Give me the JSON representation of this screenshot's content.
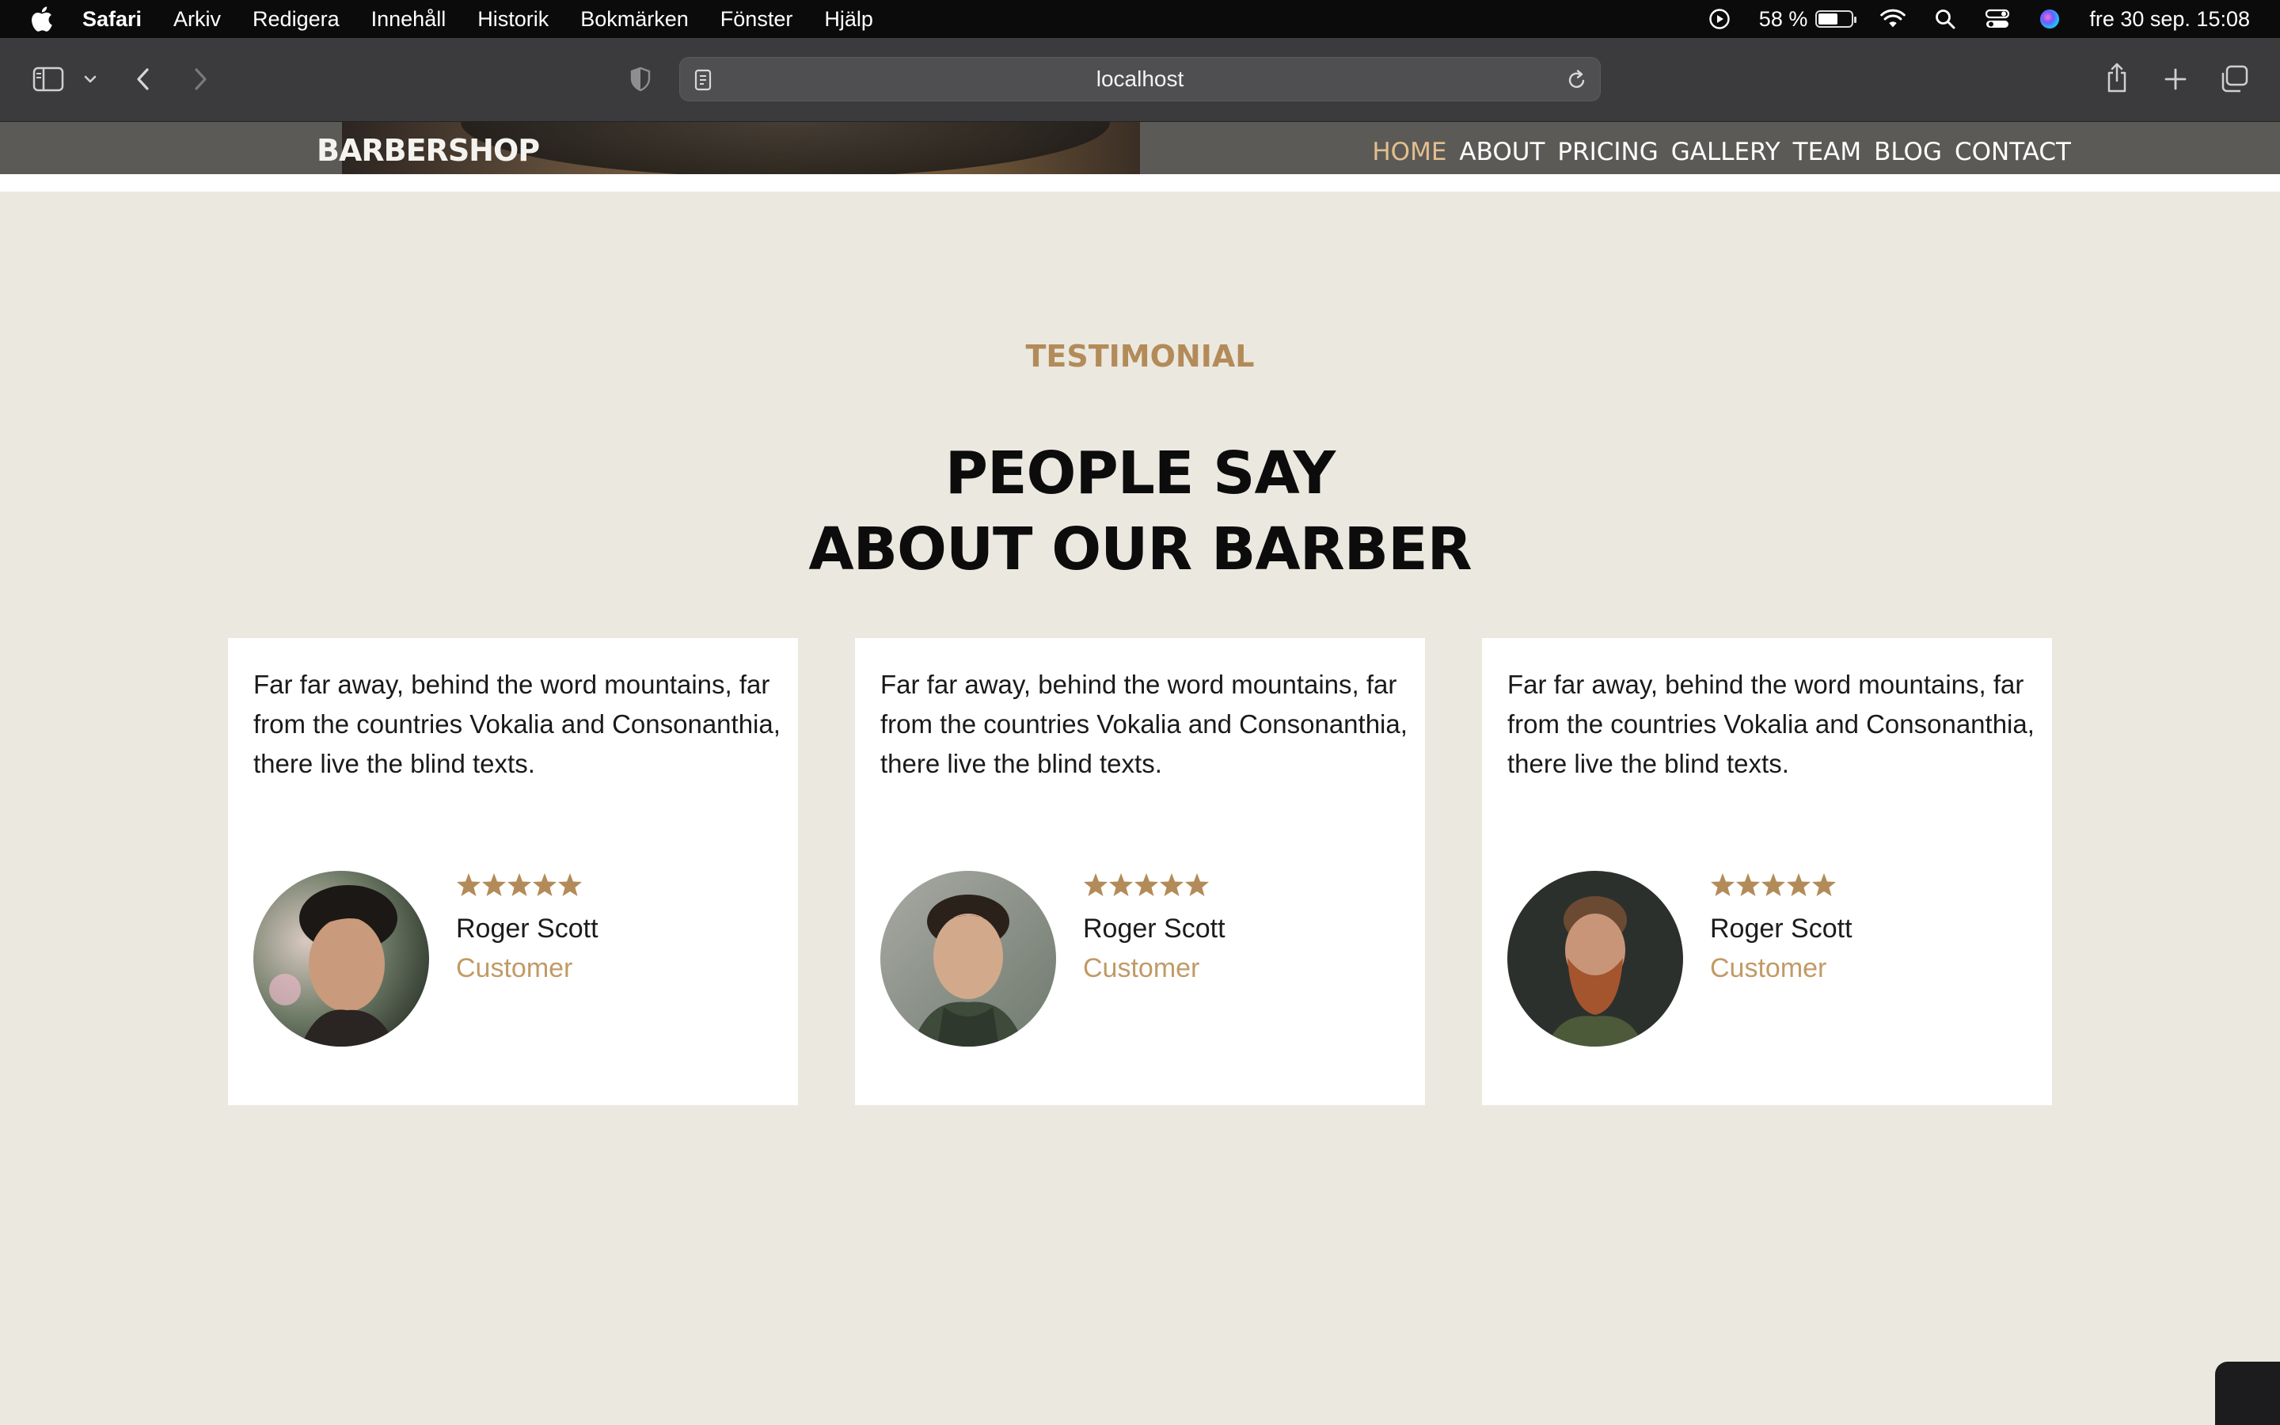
{
  "menubar": {
    "app_name": "Safari",
    "menus": [
      "Arkiv",
      "Redigera",
      "Innehåll",
      "Historik",
      "Bokmärken",
      "Fönster",
      "Hjälp"
    ],
    "battery_text": "58 %",
    "battery_level": 0.58,
    "datetime": "fre 30 sep.  15:08"
  },
  "browser": {
    "url": "localhost"
  },
  "site": {
    "logo": "BARBERSHOP",
    "nav": [
      "HOME",
      "ABOUT",
      "PRICING",
      "GALLERY",
      "TEAM",
      "BLOG",
      "CONTACT"
    ],
    "nav_active": "HOME"
  },
  "testimonial": {
    "eyebrow": "TESTIMONIAL",
    "heading_line1": "PEOPLE SAY",
    "heading_line2": "ABOUT OUR BARBER",
    "cards": [
      {
        "quote": "Far far away, behind the word mountains, far from the countries Vokalia and Consonanthia, there live the blind texts.",
        "rating": 5,
        "name": "Roger Scott",
        "role": "Customer"
      },
      {
        "quote": "Far far away, behind the word mountains, far from the countries Vokalia and Consonanthia, there live the blind texts.",
        "rating": 5,
        "name": "Roger Scott",
        "role": "Customer"
      },
      {
        "quote": "Far far away, behind the word mountains, far from the countries Vokalia and Consonanthia, there live the blind texts.",
        "rating": 5,
        "name": "Roger Scott",
        "role": "Customer"
      }
    ]
  },
  "colors": {
    "accent": "#b38b59",
    "star": "#b38b59",
    "section_bg": "#ebe8e0"
  }
}
